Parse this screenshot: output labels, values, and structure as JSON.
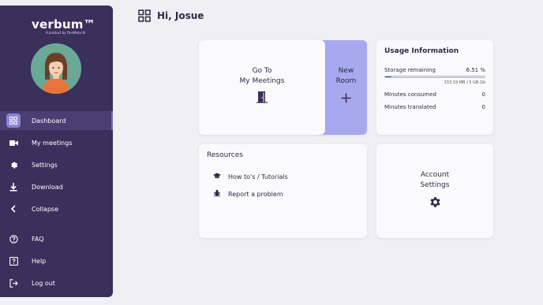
{
  "app": {
    "logo_text": "verbum™",
    "logo_subtext": "A product by OneMeta AI"
  },
  "header": {
    "greeting": "Hi, Josue"
  },
  "sidebar": {
    "items": [
      {
        "label": "Dashboard",
        "icon": "grid-icon",
        "active": true
      },
      {
        "label": "My meetings",
        "icon": "video-icon"
      },
      {
        "label": "Settings",
        "icon": "gear-icon"
      },
      {
        "label": "Download",
        "icon": "download-icon"
      },
      {
        "label": "Collapse",
        "icon": "chevron-left-icon"
      },
      {
        "label": "FAQ",
        "icon": "help-circle-icon"
      },
      {
        "label": "Help",
        "icon": "help-box-icon"
      },
      {
        "label": "Log out",
        "icon": "logout-icon"
      }
    ]
  },
  "cards": {
    "meetings": {
      "line1": "Go To",
      "line2": "My Meetings",
      "icon": "door-icon"
    },
    "new_room": {
      "line1": "New",
      "line2": "Room",
      "icon": "plus-icon"
    },
    "usage": {
      "title": "Usage Information",
      "storage_label": "Storage remaining",
      "storage_percent": "6.51 %",
      "storage_fraction": 0.0651,
      "storage_detail": "333.33 MB / 5 GB Gb",
      "minutes_consumed_label": "Minutes consumed",
      "minutes_consumed_value": "0",
      "minutes_translated_label": "Minutes translated",
      "minutes_translated_value": "0"
    },
    "resources": {
      "title": "Resources",
      "items": [
        {
          "label": "How to's / Tutorials",
          "icon": "graduation-cap-icon"
        },
        {
          "label": "Report a problem",
          "icon": "bug-icon"
        }
      ]
    },
    "account": {
      "line1": "Account",
      "line2": "Settings",
      "icon": "gear-icon"
    }
  },
  "colors": {
    "sidebar_bg": "#3b2f5c",
    "accent": "#a7a9ef",
    "active_icon_bg": "#8d84d6",
    "progress": "#4c5fc4"
  }
}
